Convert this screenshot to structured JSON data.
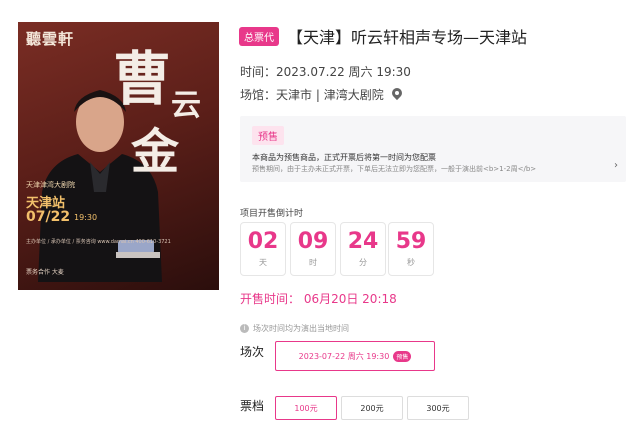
{
  "poster": {
    "brand": "聽雲軒",
    "calligraphy": [
      "曹",
      "云",
      "金"
    ],
    "tour": "天津津湾大剧院",
    "city": "天津站",
    "date": "07/22",
    "time": "19:30",
    "fine_print": "主办单位 / 承办单位 / 票务咨询 www.damai.cn 400-610-3721",
    "hotline": "票务合作 大麦"
  },
  "header": {
    "badge": "总票代",
    "title": "【天津】听云轩相声专场—天津站"
  },
  "info": {
    "time_label": "时间：",
    "time_value": "2023.07.22 周六 19:30",
    "venue_label": "场馆：",
    "venue_value": "天津市 | 津湾大剧院"
  },
  "presale": {
    "tag": "预售",
    "line1": "本商品为预售商品，正式开票后将第一时间为您配票",
    "line2": "预售期间，由于主办未正式开票，下单后无法立即为您配票，一般于演出前<b>1-2周</b>",
    "arrow": "›"
  },
  "countdown": {
    "label": "项目开售倒计时",
    "days": "02",
    "days_unit": "天",
    "hours": "09",
    "hours_unit": "时",
    "minutes": "24",
    "minutes_unit": "分",
    "seconds": "59",
    "seconds_unit": "秒"
  },
  "sale_time": "开售时间： 06月20日 20:18",
  "timezone_note": "场次时间均为演出当地时间",
  "session": {
    "label": "场次",
    "value": "2023-07-22 周六 19:30",
    "pre_badge": "预售"
  },
  "tier": {
    "label": "票档",
    "prices": [
      "100元",
      "200元",
      "300元"
    ]
  },
  "colors": {
    "accent": "#e8388a"
  }
}
